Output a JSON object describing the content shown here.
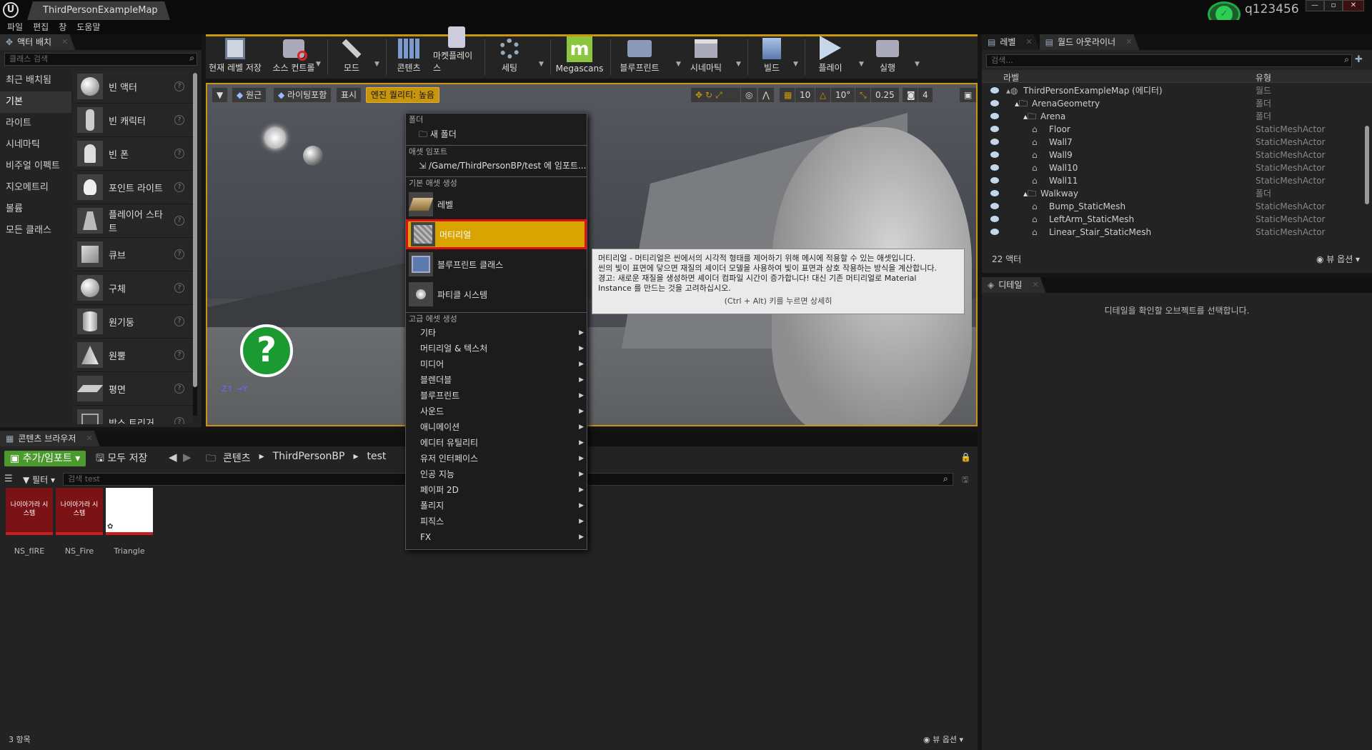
{
  "titlebar": {
    "tab": "ThirdPersonExampleMap",
    "username": "q123456"
  },
  "menu": [
    "파일",
    "편집",
    "창",
    "도움말"
  ],
  "place_panel": {
    "tab": "액터 배치",
    "search_placeholder": "클래스 검색",
    "categories": [
      "최근 배치됨",
      "기본",
      "라이트",
      "시네마틱",
      "비주얼 이펙트",
      "지오메트리",
      "볼륨",
      "모든 클래스"
    ],
    "items": [
      "빈 액터",
      "빈 캐릭터",
      "빈 폰",
      "포인트 라이트",
      "플레이어 스타트",
      "큐브",
      "구체",
      "원기둥",
      "원뿔",
      "평면",
      "박스 트리거"
    ]
  },
  "toolbar": {
    "buttons": [
      "현재 레벨 저장",
      "소스 컨트롤",
      "모드",
      "콘텐츠",
      "마켓플레이스",
      "세팅",
      "Megascans",
      "블루프린트",
      "시네마틱",
      "빌드",
      "플레이",
      "실행"
    ]
  },
  "viewport": {
    "buttons": [
      "원근",
      "라이팅포함",
      "표시",
      "엔진 퀄리티: 높음"
    ],
    "grid_snap": "10",
    "rot_snap": "10°",
    "scale_snap": "0.25",
    "cam_speed": "4"
  },
  "context_menu": {
    "sec_folder": "폴더",
    "new_folder": "새 폴더",
    "sec_import": "애셋 임포트",
    "import_to": "/Game/ThirdPersonBP/test 에 임포트...",
    "sec_basic": "기본 애셋 생성",
    "level": "레벨",
    "material": "머티리얼",
    "blueprint_class": "블루프린트 클래스",
    "particle_system": "파티클 시스템",
    "sec_advanced": "고급 에셋 생성",
    "advanced": [
      "기타",
      "머티리얼 & 텍스처",
      "미디어",
      "블렌더블",
      "블루프린트",
      "사운드",
      "애니메이션",
      "에디터 유틸리티",
      "유저 인터페이스",
      "인공 지능",
      "페이퍼 2D",
      "폴리지",
      "피직스",
      "FX"
    ]
  },
  "tooltip": {
    "line1": "머티리얼 - 머티리얼은 씬에서의 시각적 형태를 제어하기 위해 메시에 적용할 수 있는 애셋입니다.",
    "line2": "씬의 빛이 표면에 닿으면 재질의 셰이더 모델을 사용하여 빛이 표면과 상호 작용하는 방식을 계산합니다.",
    "line3": "경고: 새로운 재질을 생성하면 셰이더 컴파일 시간이 증가합니다! 대신 기존 머티리얼로 Material",
    "line4": "Instance 를 만드는 것을 고려하십시오.",
    "hint": "(Ctrl + Alt) 키를 누르면 상세히"
  },
  "content_browser": {
    "tab": "콘텐츠 브라우저",
    "add_import": "추가/임포트",
    "save_all": "모두 저장",
    "path": [
      "콘텐츠",
      "ThirdPersonBP",
      "test"
    ],
    "filter": "필터",
    "search_placeholder": "검색 test",
    "thumb_text": "나이아가라 시스템",
    "assets": [
      "NS_fIRE",
      "NS_Fire",
      "Triangle"
    ],
    "count": "3 항목",
    "view_options": "뷰 옵션"
  },
  "outliner": {
    "tab_levels": "레벨",
    "tab_outliner": "월드 아웃라이너",
    "search_placeholder": "검색...",
    "col_label": "라벨",
    "col_type": "유형",
    "rows": [
      {
        "label": "ThirdPersonExampleMap (에디터)",
        "type": "월드"
      },
      {
        "label": "ArenaGeometry",
        "type": "폴더"
      },
      {
        "label": "Arena",
        "type": "폴더"
      },
      {
        "label": "Floor",
        "type": "StaticMeshActor"
      },
      {
        "label": "Wall7",
        "type": "StaticMeshActor"
      },
      {
        "label": "Wall9",
        "type": "StaticMeshActor"
      },
      {
        "label": "Wall10",
        "type": "StaticMeshActor"
      },
      {
        "label": "Wall11",
        "type": "StaticMeshActor"
      },
      {
        "label": "Walkway",
        "type": "폴더"
      },
      {
        "label": "Bump_StaticMesh",
        "type": "StaticMeshActor"
      },
      {
        "label": "LeftArm_StaticMesh",
        "type": "StaticMeshActor"
      },
      {
        "label": "Linear_Stair_StaticMesh",
        "type": "StaticMeshActor"
      }
    ],
    "count": "22 액터",
    "view_options": "뷰 옵션"
  },
  "details": {
    "tab": "디테일",
    "empty": "디테일을 확인할 오브젝트를 선택합니다."
  },
  "colors": {
    "accent": "#d9a300",
    "highlight_border": "#e01010",
    "add_button": "#4a9a2e",
    "viewport_border": "#c8960c"
  }
}
